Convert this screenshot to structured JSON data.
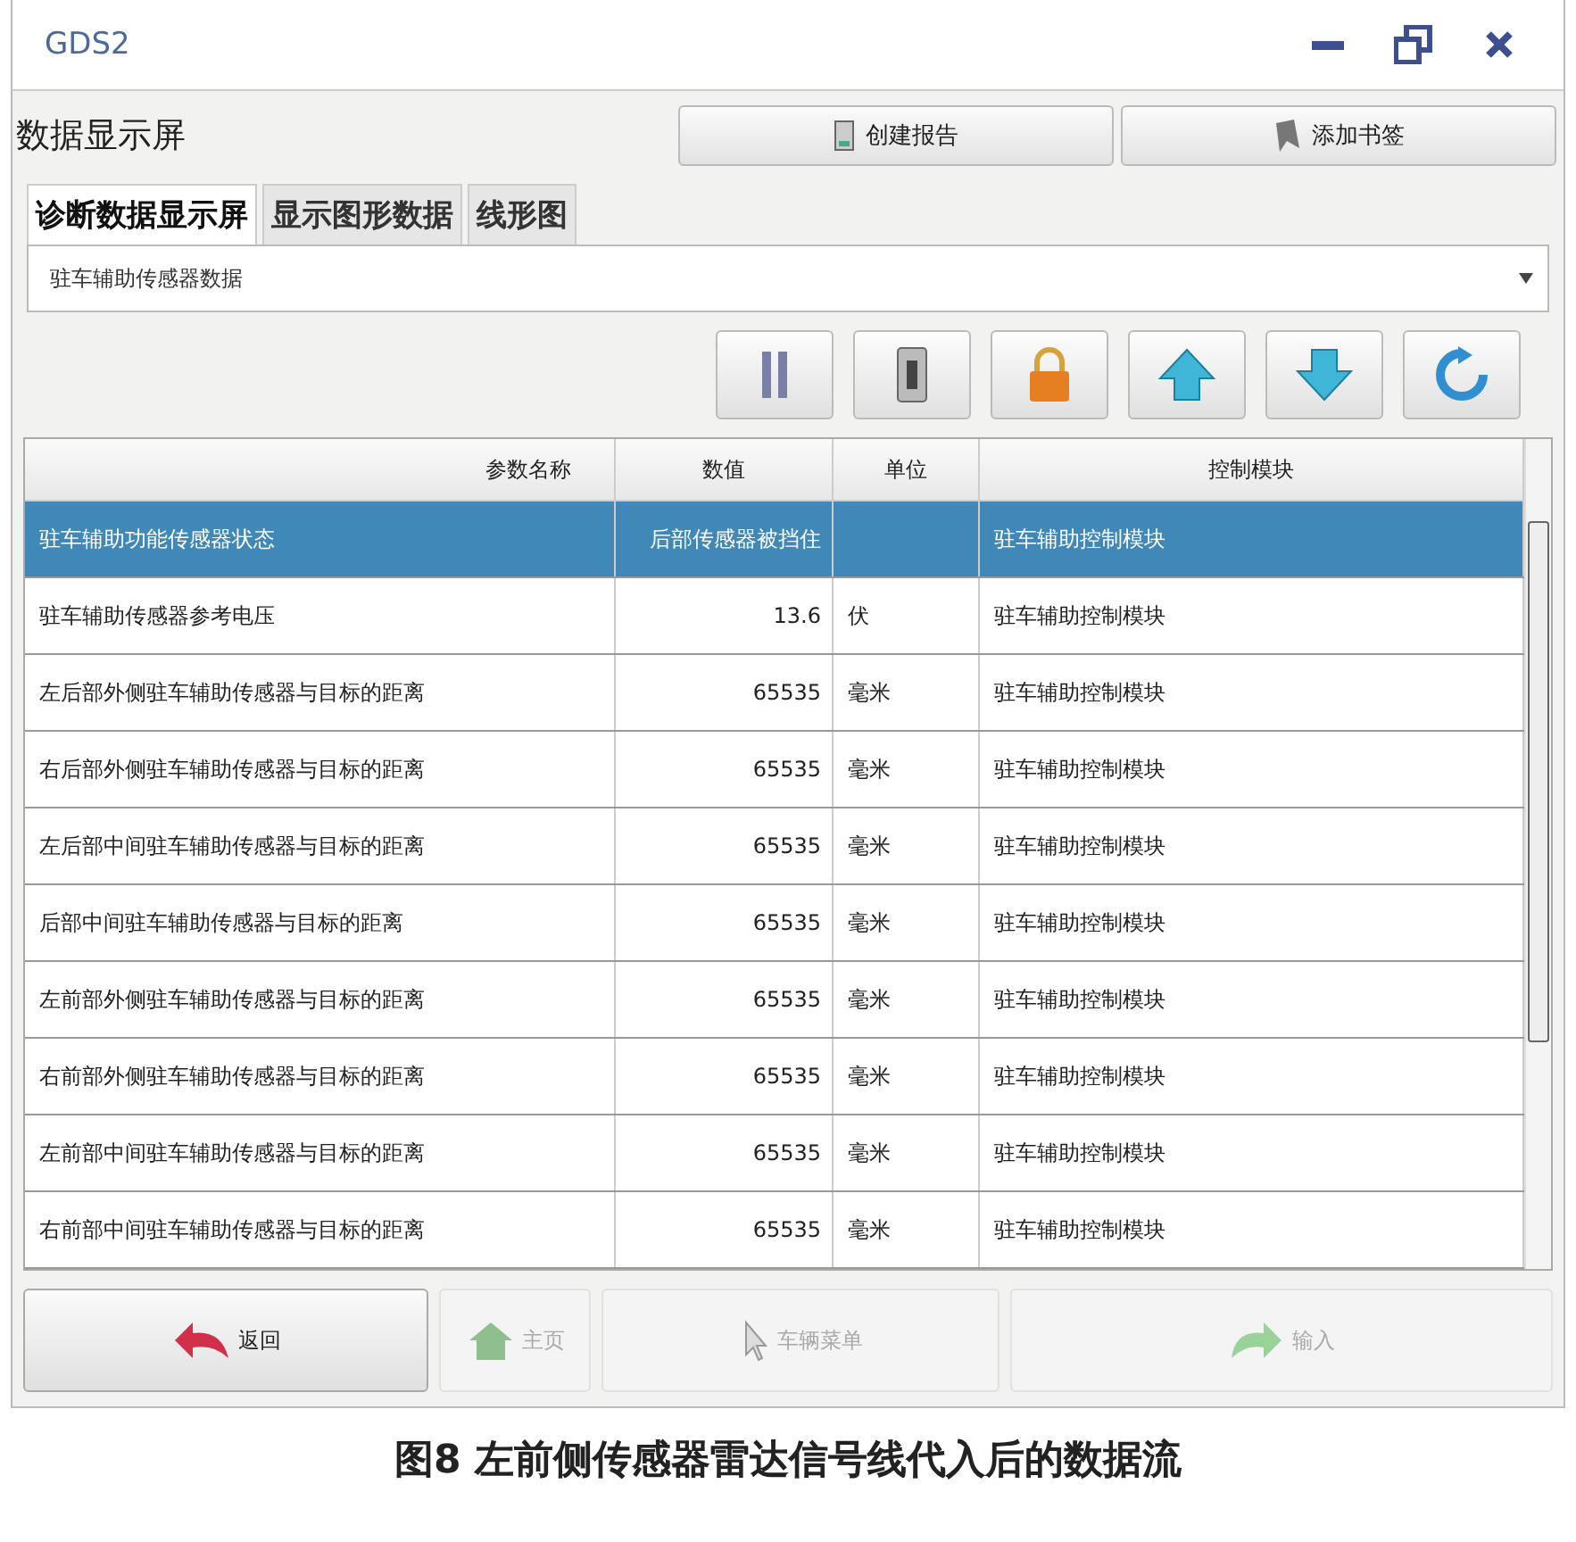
{
  "window": {
    "title": "GDS2"
  },
  "header": {
    "title": "数据显示屏",
    "buttons": [
      {
        "label": "创建报告"
      },
      {
        "label": "添加书签"
      }
    ]
  },
  "tabs": [
    {
      "label": "诊断数据显示屏",
      "selected": true
    },
    {
      "label": "显示图形数据",
      "selected": false
    },
    {
      "label": "线形图",
      "selected": false
    }
  ],
  "dropdown": {
    "value": "驻车辅助传感器数据"
  },
  "table": {
    "columns": [
      "参数名称",
      "数值",
      "单位",
      "控制模块"
    ],
    "rows": [
      {
        "name": "驻车辅助功能传感器状态",
        "value": "后部传感器被挡住",
        "unit": "",
        "module": "驻车辅助控制模块",
        "selected": true
      },
      {
        "name": "驻车辅助传感器参考电压",
        "value": "13.6",
        "unit": "伏",
        "module": "驻车辅助控制模块",
        "selected": false
      },
      {
        "name": "左后部外侧驻车辅助传感器与目标的距离",
        "value": "65535",
        "unit": "毫米",
        "module": "驻车辅助控制模块",
        "selected": false
      },
      {
        "name": "右后部外侧驻车辅助传感器与目标的距离",
        "value": "65535",
        "unit": "毫米",
        "module": "驻车辅助控制模块",
        "selected": false
      },
      {
        "name": "左后部中间驻车辅助传感器与目标的距离",
        "value": "65535",
        "unit": "毫米",
        "module": "驻车辅助控制模块",
        "selected": false
      },
      {
        "name": "后部中间驻车辅助传感器与目标的距离",
        "value": "65535",
        "unit": "毫米",
        "module": "驻车辅助控制模块",
        "selected": false
      },
      {
        "name": "左前部外侧驻车辅助传感器与目标的距离",
        "value": "65535",
        "unit": "毫米",
        "module": "驻车辅助控制模块",
        "selected": false
      },
      {
        "name": "右前部外侧驻车辅助传感器与目标的距离",
        "value": "65535",
        "unit": "毫米",
        "module": "驻车辅助控制模块",
        "selected": false
      },
      {
        "name": "左前部中间驻车辅助传感器与目标的距离",
        "value": "65535",
        "unit": "毫米",
        "module": "驻车辅助控制模块",
        "selected": false
      },
      {
        "name": "右前部中间驻车辅助传感器与目标的距离",
        "value": "65535",
        "unit": "毫米",
        "module": "驻车辅助控制模块",
        "selected": false
      }
    ]
  },
  "footer": [
    {
      "label": "返回",
      "disabled": false
    },
    {
      "label": "主页",
      "disabled": true
    },
    {
      "label": "车辆菜单",
      "disabled": true
    },
    {
      "label": "输入",
      "disabled": true
    }
  ],
  "caption": "图8 左前侧传感器雷达信号线代入后的数据流"
}
